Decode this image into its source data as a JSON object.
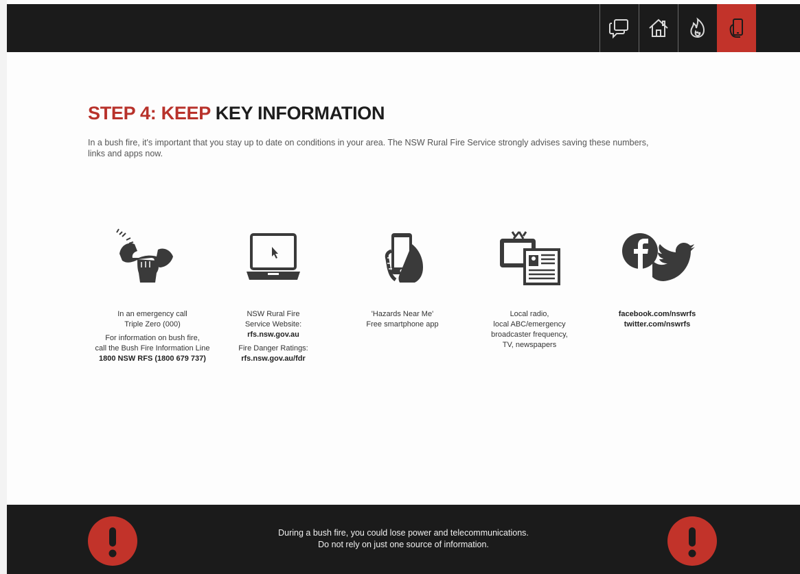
{
  "nav": {
    "items": [
      {
        "icon": "chat-bubbles-icon",
        "active": false
      },
      {
        "icon": "home-icon",
        "active": false
      },
      {
        "icon": "fire-icon",
        "active": false
      },
      {
        "icon": "phone-in-hand-icon",
        "active": true
      }
    ],
    "active_color": "#c2332a"
  },
  "heading": {
    "red_part": "STEP 4: KEEP",
    "dark_part": "KEY INFORMATION"
  },
  "intro": "In a bush fire, it's important that you stay up to date on conditions in your area. The NSW Rural Fire Service strongly advises saving these numbers, links and apps now.",
  "columns": {
    "emergency": {
      "icon": "ringing-phone-in-hand-icon",
      "line1": "In an emergency call",
      "line2": "Triple Zero (000)",
      "line3": "For information on bush fire,",
      "line4": "call the Bush Fire Information Line",
      "line5": "1800 NSW RFS (1800 679 737)"
    },
    "website": {
      "icon": "laptop-icon",
      "line1": "NSW Rural Fire",
      "line2": "Service Website:",
      "line3": "rfs.nsw.gov.au",
      "line4": "Fire Danger Ratings:",
      "line5": "rfs.nsw.gov.au/fdr"
    },
    "app": {
      "icon": "smartphone-in-hand-icon",
      "line1": "'Hazards Near Me'",
      "line2": "Free smartphone app"
    },
    "media": {
      "icon": "tv-and-newspaper-icon",
      "line1": "Local radio,",
      "line2": "local ABC/emergency",
      "line3": "broadcaster frequency,",
      "line4": "TV, newspapers"
    },
    "social": {
      "icon": "facebook-twitter-icon",
      "line1": "facebook.com/nswrfs",
      "line2": "twitter.com/nswrfs"
    }
  },
  "footer": {
    "line1": "During a bush fire, you could lose power and telecommunications.",
    "line2": "Do not rely on just one source of information.",
    "alert_icon": "exclamation-circle-icon"
  }
}
